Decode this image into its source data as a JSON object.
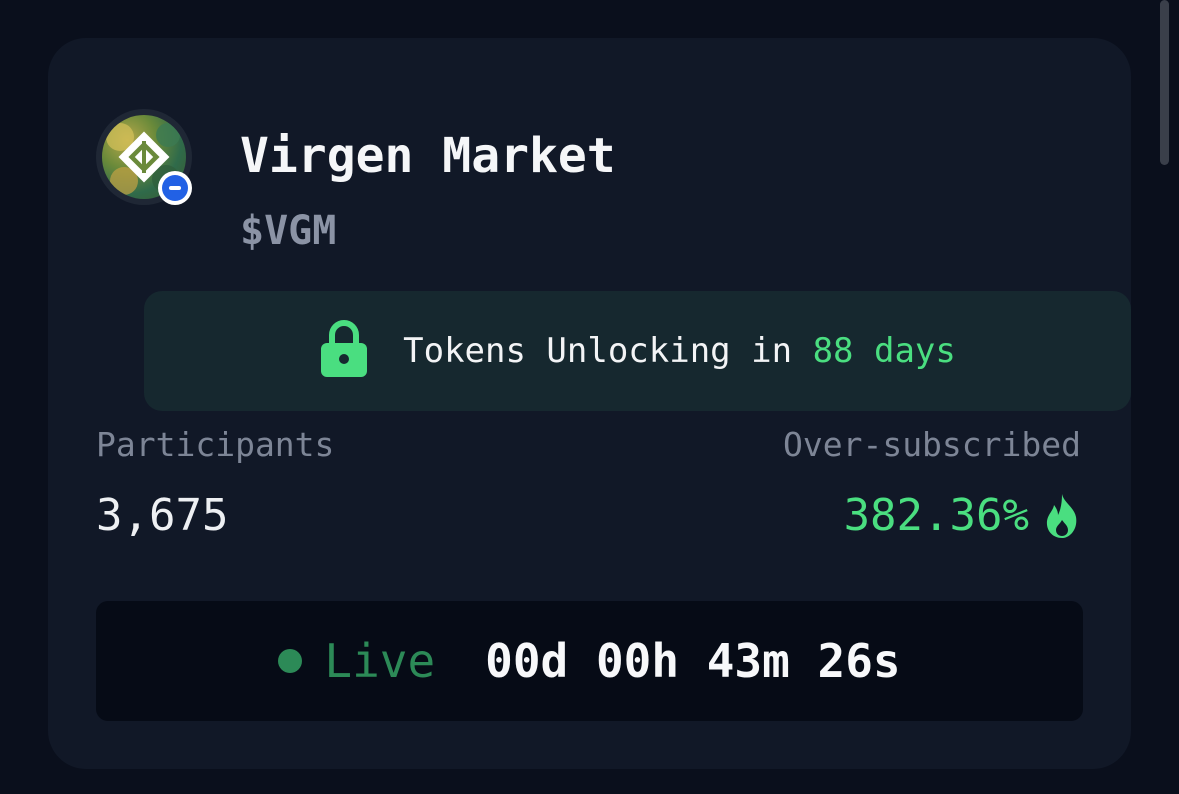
{
  "project": {
    "name": "Virgen Market",
    "ticker": "$VGM"
  },
  "unlock": {
    "prefix": "Tokens Unlocking in",
    "days": "88 days"
  },
  "stats": {
    "participants_label": "Participants",
    "participants_value": "3,675",
    "oversubscribed_label": "Over-subscribed",
    "oversubscribed_value": "382.36%"
  },
  "status": {
    "label": "Live",
    "countdown": "00d 00h 43m 26s"
  },
  "colors": {
    "accent_green": "#4ade80",
    "live_green": "#2c8a57",
    "chain_blue": "#2261e5",
    "card_bg": "#111827",
    "banner_bg": "#16282f"
  },
  "icons": {
    "project_logo": "project-logo-icon",
    "chain_badge": "chain-badge-icon",
    "lock": "lock-icon",
    "fire": "fire-icon",
    "live_dot": "live-dot-icon"
  }
}
